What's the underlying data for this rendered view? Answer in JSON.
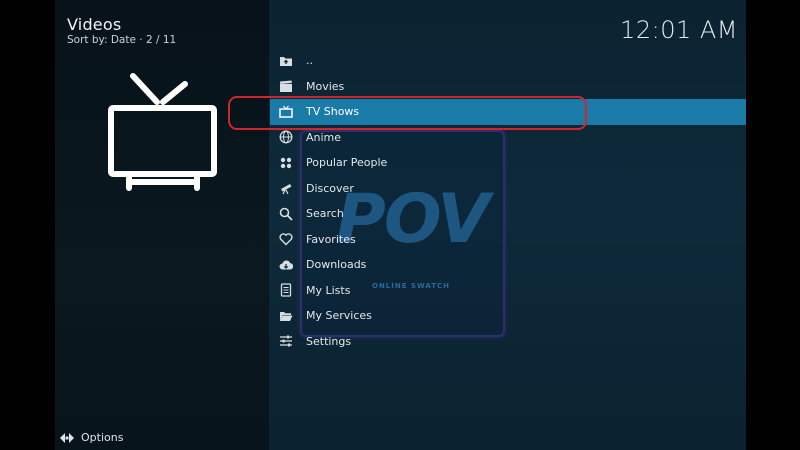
{
  "header": {
    "title": "Videos",
    "sort_label": "Sort by: Date",
    "position": "2 / 11",
    "clock": "12:01 AM"
  },
  "menu": {
    "items": [
      {
        "label": "..",
        "icon": "folder-up-icon"
      },
      {
        "label": "Movies",
        "icon": "clapperboard-icon"
      },
      {
        "label": "TV Shows",
        "icon": "tv-icon",
        "focused": true
      },
      {
        "label": "Anime",
        "icon": "globe-icon"
      },
      {
        "label": "Popular People",
        "icon": "people-icon"
      },
      {
        "label": "Discover",
        "icon": "telescope-icon"
      },
      {
        "label": "Search",
        "icon": "search-icon"
      },
      {
        "label": "Favorites",
        "icon": "heart-icon"
      },
      {
        "label": "Downloads",
        "icon": "cloud-download-icon"
      },
      {
        "label": "My Lists",
        "icon": "list-icon"
      },
      {
        "label": "My Services",
        "icon": "folder-open-icon"
      },
      {
        "label": "Settings",
        "icon": "sliders-icon"
      }
    ]
  },
  "addon": {
    "logo_text": "POV",
    "logo_subtext": "ONLINE SWATCH"
  },
  "footer": {
    "options_label": "Options"
  },
  "colors": {
    "focus": "#1a7aa8",
    "highlight_ring": "#d0252b"
  }
}
